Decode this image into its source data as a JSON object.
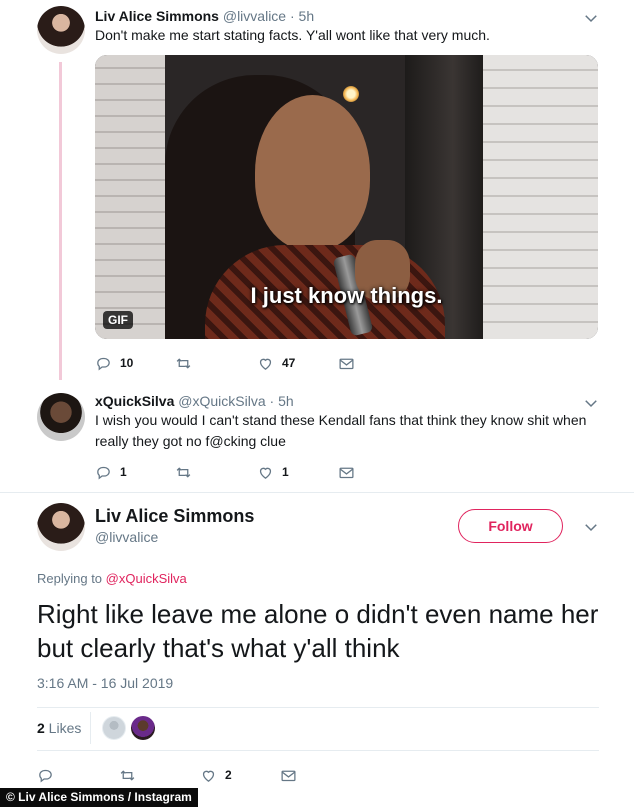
{
  "tweet1": {
    "display_name": "Liv Alice Simmons",
    "handle": "@livvalice",
    "sep": " · ",
    "time": "5h",
    "text": "Don't make me start stating facts. Y'all wont like that very much.",
    "media": {
      "caption": "I just know things.",
      "badge": "GIF"
    },
    "actions": {
      "replies": "10",
      "retweets": "",
      "likes": "47"
    }
  },
  "tweet2": {
    "display_name": "xQuickSilva",
    "handle": "@xQuickSilva",
    "sep": " · ",
    "time": "5h",
    "text": "I wish you would I can't stand these Kendall fans that think they know shit when really they got no f@cking clue",
    "actions": {
      "replies": "1",
      "retweets": "",
      "likes": "1"
    }
  },
  "main_tweet": {
    "display_name": "Liv Alice Simmons",
    "handle": "@livvalice",
    "follow_label": "Follow",
    "replying_prefix": "Replying to ",
    "replying_to": "@xQuickSilva",
    "text": "Right like leave me alone o didn't even name her but clearly that's what y'all think",
    "timestamp": "3:16 AM - 16 Jul 2019",
    "likes_count": "2",
    "likes_label": " Likes",
    "actions": {
      "replies": "",
      "retweets": "",
      "likes": "2"
    }
  },
  "credit": "© Liv Alice Simmons / Instagram",
  "colors": {
    "accent": "#e0245e",
    "thread_line": "#f2c9d8",
    "muted": "#657786",
    "text": "#14171a"
  },
  "icons": {
    "reply": "reply-icon",
    "retweet": "retweet-icon",
    "like": "heart-icon",
    "dm": "envelope-icon",
    "more": "chevron-down-icon"
  }
}
